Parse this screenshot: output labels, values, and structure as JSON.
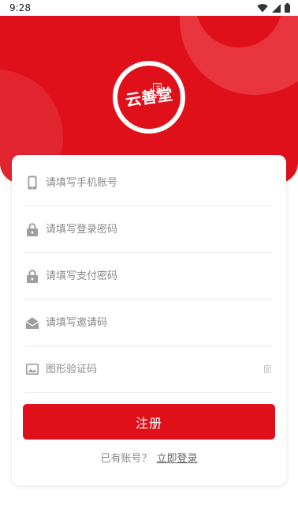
{
  "status_bar": {
    "time": "9:28",
    "icons": [
      "wifi-icon",
      "signal-icon",
      "battery-icon"
    ]
  },
  "brand": {
    "logo_text": "云善堂",
    "logo_seal_text": "云善",
    "primary_color": "#e0101b"
  },
  "form": {
    "fields": [
      {
        "name": "phone",
        "icon": "phone-icon",
        "placeholder": "请填写手机账号"
      },
      {
        "name": "login_password",
        "icon": "lock-icon",
        "placeholder": "请填写登录密码"
      },
      {
        "name": "pay_password",
        "icon": "lock-icon",
        "placeholder": "请填写支付密码"
      },
      {
        "name": "invite_code",
        "icon": "mail-open-icon",
        "placeholder": "请填写邀请码"
      },
      {
        "name": "captcha",
        "icon": "image-icon",
        "placeholder": "图形验证码"
      }
    ],
    "submit_label": "注册",
    "login_prompt": "已有账号？",
    "login_link": "立即登录"
  }
}
